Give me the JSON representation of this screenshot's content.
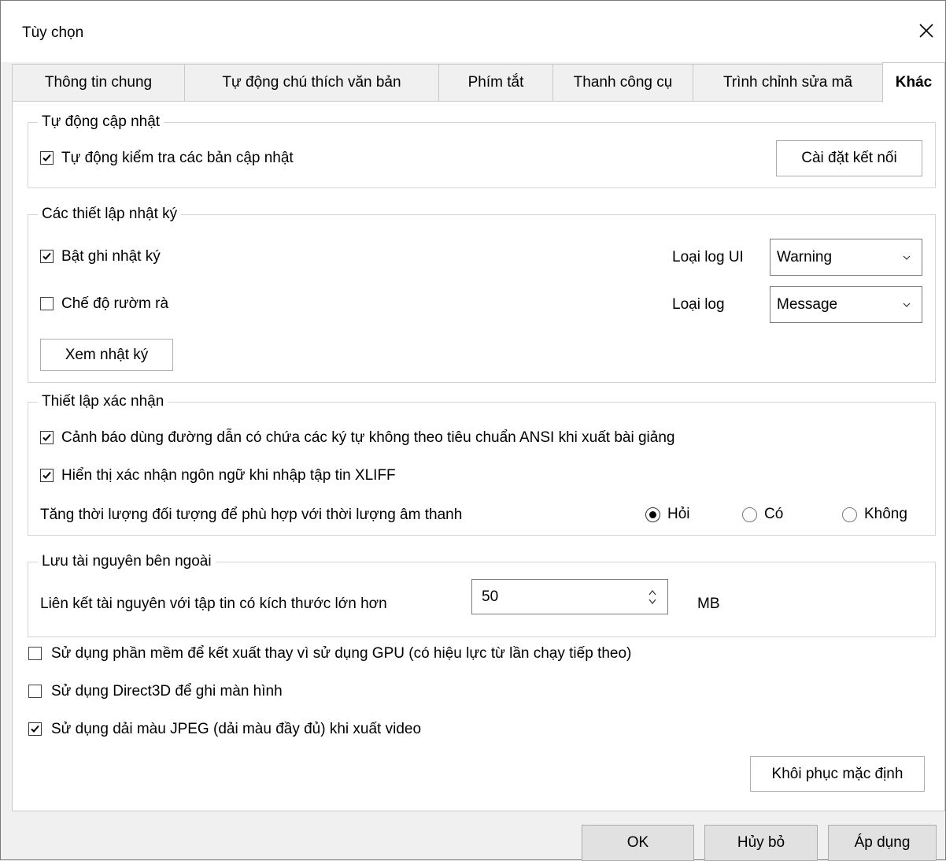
{
  "window": {
    "title": "Tùy chọn"
  },
  "tabs": [
    {
      "label": "Thông tin chung"
    },
    {
      "label": "Tự động chú thích văn bản"
    },
    {
      "label": "Phím tắt"
    },
    {
      "label": "Thanh công cụ"
    },
    {
      "label": "Trình chỉnh sửa mã"
    },
    {
      "label": "Khác",
      "active": true
    }
  ],
  "auto_update": {
    "legend": "Tự động cập nhật",
    "check_label": "Tự động kiểm tra các bản cập nhật",
    "checked": true,
    "connection_button": "Cài đặt kết nối"
  },
  "log_settings": {
    "legend": "Các thiết lập nhật ký",
    "enable_log_label": "Bật ghi nhật ký",
    "enable_log_checked": true,
    "verbose_label": "Chế độ rườm rà",
    "verbose_checked": false,
    "ui_log_type_label": "Loại log UI",
    "ui_log_type_value": "Warning",
    "log_type_label": "Loại log",
    "log_type_value": "Message",
    "view_log_button": "Xem nhật ký"
  },
  "confirmation": {
    "legend": "Thiết lập xác nhận",
    "ansi_warning_label": "Cảnh báo dùng đường dẫn có chứa các ký tự không theo tiêu chuẩn ANSI khi xuất bài giảng",
    "ansi_warning_checked": true,
    "xliff_label": "Hiển thị xác nhận ngôn ngữ khi nhập tập tin XLIFF",
    "xliff_checked": true,
    "duration_label": "Tăng thời lượng đối tượng để phù hợp với thời lượng âm thanh",
    "duration_options": [
      "Hỏi",
      "Có",
      "Không"
    ],
    "duration_selected": "Hỏi"
  },
  "external_resources": {
    "legend": "Lưu tài nguyên bên ngoài",
    "link_label": "Liên kết tài nguyên với tập tin có kích thước lớn hơn",
    "size_value": "50",
    "unit": "MB"
  },
  "misc": {
    "software_render_label": "Sử dụng phần mềm để kết xuất thay vì sử dụng GPU (có hiệu lực từ lần chạy tiếp theo)",
    "software_render_checked": false,
    "direct3d_label": "Sử dụng Direct3D để ghi màn hình",
    "direct3d_checked": false,
    "jpeg_range_label": "Sử dụng dải màu JPEG (dải màu đầy đủ) khi xuất video",
    "jpeg_range_checked": true,
    "restore_button": "Khôi phục mặc định"
  },
  "footer": {
    "ok_button": "OK",
    "cancel_button": "Hủy bỏ",
    "apply_button": "Áp dụng"
  }
}
